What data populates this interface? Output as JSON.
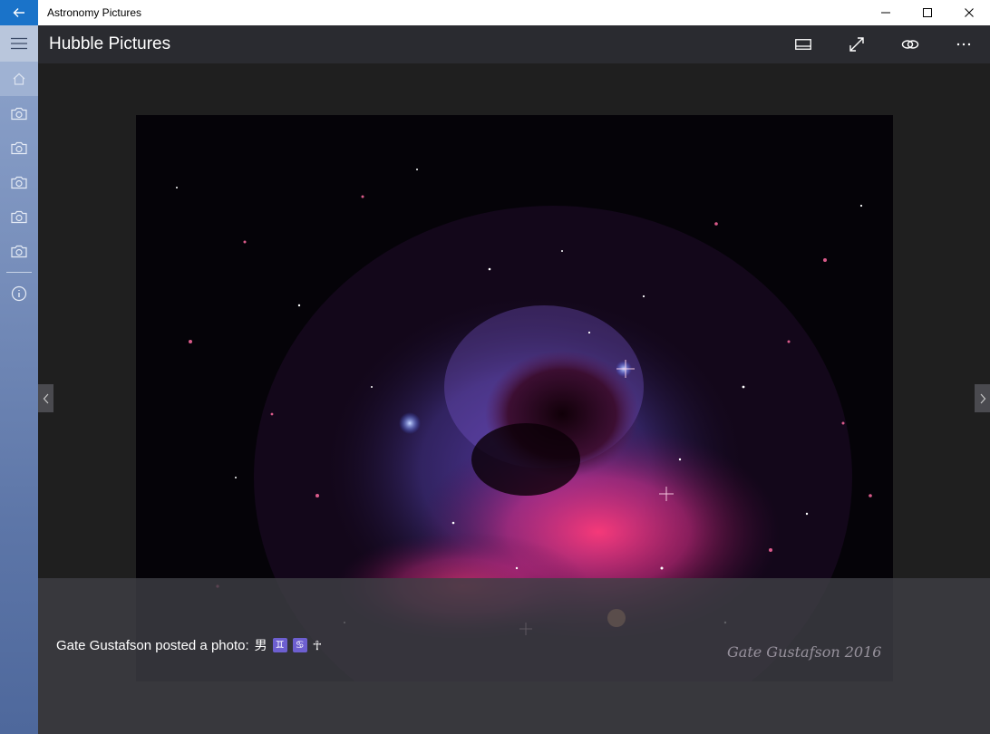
{
  "window": {
    "title": "Astronomy Pictures"
  },
  "header": {
    "title": "Hubble Pictures"
  },
  "caption": {
    "text": "Gate Gustafson posted a photo:",
    "glyphs": [
      "男",
      "♊",
      "♋",
      "☥"
    ]
  },
  "photo": {
    "signature": "Gate Gustafson 2016"
  },
  "sidebar": {
    "items": [
      "hamburger-icon",
      "home-icon",
      "camera-icon",
      "camera-icon",
      "camera-icon",
      "camera-icon",
      "camera-icon",
      "info-icon"
    ]
  },
  "colors": {
    "accent": "#1a73c9",
    "header_bg": "#2a2b30",
    "content_bg": "#1f1f1f"
  }
}
